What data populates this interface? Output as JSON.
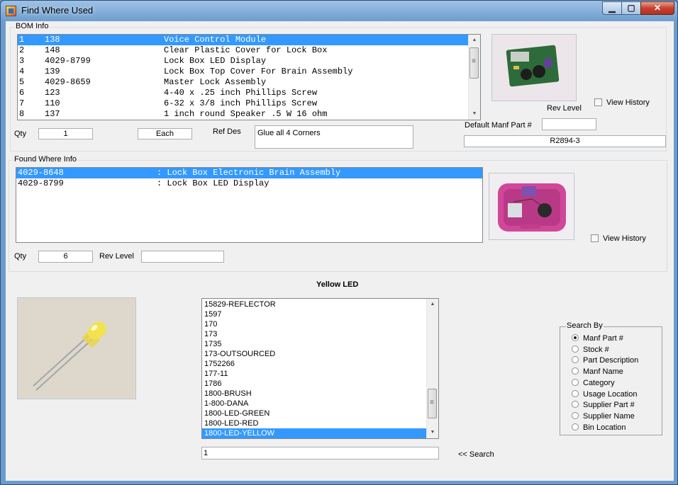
{
  "window": {
    "title": "Find Where Used",
    "min_glyph": "▁",
    "max_glyph": "▢",
    "close_glyph": "✕"
  },
  "bom_info": {
    "label": "BOM Info",
    "rows": [
      {
        "num": "1",
        "part": "138",
        "desc": "Voice Control Module",
        "selected": true
      },
      {
        "num": "2",
        "part": "148",
        "desc": "Clear Plastic Cover for Lock Box"
      },
      {
        "num": "3",
        "part": "4029-8799",
        "desc": "Lock Box LED Display"
      },
      {
        "num": "4",
        "part": "139",
        "desc": "Lock Box Top Cover For Brain Assembly"
      },
      {
        "num": "5",
        "part": "4029-8659",
        "desc": "Master Lock Assembly"
      },
      {
        "num": "6",
        "part": "123",
        "desc": "4-40 x .25 inch Phillips Screw"
      },
      {
        "num": "7",
        "part": "110",
        "desc": "6-32 x 3/8 inch Phillips Screw"
      },
      {
        "num": "8",
        "part": "137",
        "desc": "1 inch round Speaker .5 W 16 ohm"
      }
    ],
    "qty_label": "Qty",
    "qty_value": "1",
    "unit_value": "Each",
    "refdes_label": "Ref Des",
    "refdes_value": "Glue all 4 Corners",
    "rev_level_label": "Rev Level",
    "rev_level_value": "",
    "view_history_label": "View History",
    "default_manf_label": "Default Manf Part #",
    "default_manf_value": "R2894-3"
  },
  "found_where": {
    "label": "Found Where Info",
    "rows": [
      {
        "part": "4029-8648",
        "desc": ": Lock Box Electronic Brain Assembly",
        "selected": true
      },
      {
        "part": "4029-8799",
        "desc": ": Lock Box LED Display"
      }
    ],
    "qty_label": "Qty",
    "qty_value": "6",
    "rev_level_label": "Rev Level",
    "rev_level_value": "",
    "view_history_label": "View History"
  },
  "part_caption": "Yellow LED",
  "parts_list": [
    "15829-REFLECTOR",
    "1597",
    "170",
    "173",
    "1735",
    "173-OUTSOURCED",
    "1752266",
    "177-11",
    "1786",
    "1800-BRUSH",
    "1-800-DANA",
    "1800-LED-GREEN",
    "1800-LED-RED",
    "1800-LED-YELLOW"
  ],
  "parts_selected_index": 13,
  "search_input_value": "1",
  "search_button_label": "<< Search",
  "search_by": {
    "label": "Search By",
    "options": [
      "Manf Part #",
      "Stock #",
      "Part Description",
      "Manf Name",
      "Category",
      "Usage Location",
      "Supplier Part #",
      "Supplier Name",
      "Bin Location"
    ],
    "selected_index": 0
  },
  "icons": {
    "scroll_up": "▲",
    "scroll_down": "▼"
  }
}
